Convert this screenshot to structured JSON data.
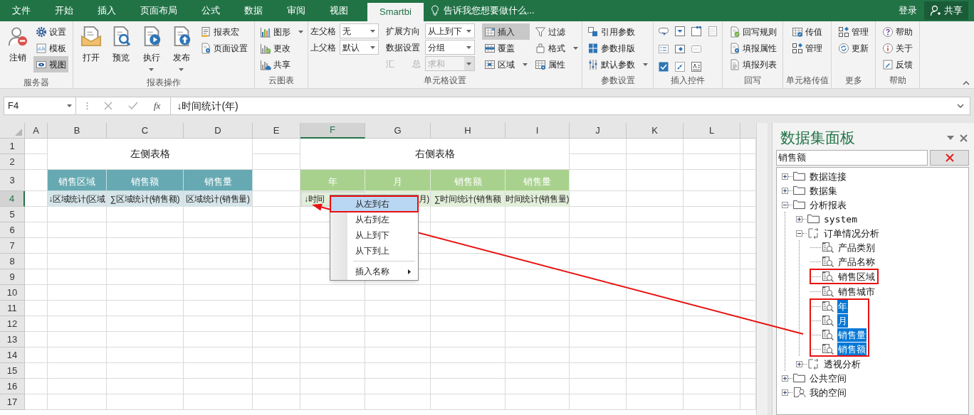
{
  "tabs": [
    {
      "label": "文件",
      "selected": false
    },
    {
      "label": "开始",
      "selected": false
    },
    {
      "label": "插入",
      "selected": false
    },
    {
      "label": "页面布局",
      "selected": false
    },
    {
      "label": "公式",
      "selected": false
    },
    {
      "label": "数据",
      "selected": false
    },
    {
      "label": "审阅",
      "selected": false
    },
    {
      "label": "视图",
      "selected": false
    },
    {
      "label": "Smartbi",
      "selected": true
    }
  ],
  "tell_me": "告诉我您想要做什么...",
  "sign_in": "登录",
  "share_button": "共享",
  "ribbon": {
    "groups": [
      {
        "label": "服务器",
        "columns": [
          {
            "kind": "large",
            "buttons": [
              {
                "label": "注销",
                "pressed": false,
                "caret": false
              }
            ]
          },
          {
            "kind": "small",
            "buttons": [
              {
                "label": "设置",
                "pressed": false,
                "caret": false
              },
              {
                "label": "模板",
                "pressed": false,
                "caret": false
              },
              {
                "label": "视图",
                "pressed": true,
                "caret": false
              }
            ]
          }
        ]
      },
      {
        "label": "报表操作",
        "columns": [
          {
            "kind": "large",
            "buttons": [
              {
                "label": "打开",
                "pressed": false,
                "caret": false
              }
            ]
          },
          {
            "kind": "large",
            "buttons": [
              {
                "label": "预览",
                "pressed": false,
                "caret": false
              }
            ]
          },
          {
            "kind": "large",
            "buttons": [
              {
                "label": "执行",
                "pressed": false,
                "caret": true
              }
            ]
          },
          {
            "kind": "large",
            "buttons": [
              {
                "label": "发布",
                "pressed": false,
                "caret": true
              }
            ]
          },
          {
            "kind": "small",
            "buttons": [
              {
                "label": "报表宏",
                "pressed": false,
                "caret": false
              },
              {
                "label": "页面设置",
                "pressed": false,
                "caret": false
              }
            ]
          }
        ]
      },
      {
        "label": "云图表",
        "columns": [
          {
            "kind": "small",
            "buttons": [
              {
                "label": "图形",
                "pressed": false,
                "caret": true
              },
              {
                "label": "更改",
                "pressed": false,
                "caret": false
              },
              {
                "label": "共享",
                "pressed": false,
                "caret": false
              }
            ]
          }
        ]
      },
      {
        "label": "单元格设置",
        "columns": [
          {
            "kind": "fields",
            "fields": [
              {
                "label": "左父格",
                "value": "无",
                "disabled": false
              },
              {
                "label": "上父格",
                "value": "默认",
                "disabled": false
              }
            ]
          },
          {
            "kind": "fields",
            "fields": [
              {
                "label": "扩展方向",
                "value": "从上到下",
                "disabled": false
              },
              {
                "label": "数据设置",
                "value": "分组",
                "disabled": false
              },
              {
                "label": "汇 总",
                "value": "求和",
                "disabled": true
              }
            ]
          },
          {
            "kind": "small",
            "buttons": [
              {
                "label": "插入",
                "pressed": true,
                "caret": false
              },
              {
                "label": "覆盖",
                "pressed": false,
                "caret": false
              },
              {
                "label": "区域",
                "pressed": false,
                "caret": true
              }
            ]
          },
          {
            "kind": "small",
            "buttons": [
              {
                "label": "过滤",
                "pressed": false,
                "caret": false
              },
              {
                "label": "格式",
                "pressed": false,
                "caret": true
              },
              {
                "label": "属性",
                "pressed": false,
                "caret": false
              }
            ]
          }
        ]
      },
      {
        "label": "参数设置",
        "columns": [
          {
            "kind": "small",
            "buttons": [
              {
                "label": "引用参数",
                "pressed": false,
                "caret": false
              },
              {
                "label": "参数排版",
                "pressed": false,
                "caret": false
              },
              {
                "label": "默认参数",
                "pressed": false,
                "caret": true
              }
            ]
          }
        ]
      },
      {
        "label": "插入控件",
        "columns": [
          {
            "kind": "controls"
          }
        ]
      },
      {
        "label": "回写",
        "columns": [
          {
            "kind": "small",
            "buttons": [
              {
                "label": "回写规则",
                "pressed": false,
                "caret": false
              },
              {
                "label": "填报属性",
                "pressed": false,
                "caret": false
              },
              {
                "label": "填报列表",
                "pressed": false,
                "caret": false
              }
            ]
          }
        ]
      },
      {
        "label": "单元格传值",
        "columns": [
          {
            "kind": "small",
            "buttons": [
              {
                "label": "传值",
                "pressed": false,
                "caret": false
              },
              {
                "label": "管理",
                "pressed": false,
                "caret": false
              }
            ]
          }
        ]
      },
      {
        "label": "更多",
        "columns": [
          {
            "kind": "small",
            "buttons": [
              {
                "label": "管理",
                "pressed": false,
                "caret": false
              },
              {
                "label": "更新",
                "pressed": false,
                "caret": false
              }
            ]
          }
        ]
      },
      {
        "label": "帮助",
        "columns": [
          {
            "kind": "small",
            "buttons": [
              {
                "label": "帮助",
                "pressed": false,
                "caret": false
              },
              {
                "label": "关于",
                "pressed": false,
                "caret": false
              },
              {
                "label": "反馈",
                "pressed": false,
                "caret": false
              }
            ]
          }
        ]
      }
    ]
  },
  "formula_bar": {
    "name_box": "F4",
    "function_label": "fx",
    "formula": "↓时间统计(年)"
  },
  "sheet": {
    "columns": [
      {
        "label": "A",
        "selected": false
      },
      {
        "label": "B",
        "selected": false
      },
      {
        "label": "C",
        "selected": false
      },
      {
        "label": "D",
        "selected": false
      },
      {
        "label": "E",
        "selected": false
      },
      {
        "label": "F",
        "selected": true
      },
      {
        "label": "G",
        "selected": false
      },
      {
        "label": "H",
        "selected": false
      },
      {
        "label": "I",
        "selected": false
      },
      {
        "label": "J",
        "selected": false
      },
      {
        "label": "K",
        "selected": false
      },
      {
        "label": "L",
        "selected": false
      }
    ],
    "rows": [
      {
        "label": "1",
        "selected": false
      },
      {
        "label": "2",
        "selected": false
      },
      {
        "label": "3",
        "selected": false
      },
      {
        "label": "4",
        "selected": true
      },
      {
        "label": "5",
        "selected": false
      },
      {
        "label": "6",
        "selected": false
      },
      {
        "label": "7",
        "selected": false
      },
      {
        "label": "8",
        "selected": false
      },
      {
        "label": "9",
        "selected": false
      },
      {
        "label": "10",
        "selected": false
      },
      {
        "label": "11",
        "selected": false
      },
      {
        "label": "12",
        "selected": false
      },
      {
        "label": "13",
        "selected": false
      },
      {
        "label": "14",
        "selected": false
      },
      {
        "label": "15",
        "selected": false
      },
      {
        "label": "16",
        "selected": false
      },
      {
        "label": "17",
        "selected": false
      }
    ],
    "left_table": {
      "title": "左侧表格",
      "headers": [
        "销售区域",
        "销售额",
        "销售量"
      ],
      "values": [
        {
          "text": "↓区域统计(区域",
          "kind": "text",
          "selected": false
        },
        {
          "text": "∑区域统计(销售额)",
          "kind": "text",
          "selected": false
        },
        {
          "text": "区域统计(销售量)",
          "kind": "text",
          "selected": false
        }
      ]
    },
    "right_table": {
      "title": "右侧表格",
      "headers": [
        "年",
        "月",
        "销售额",
        "销售量"
      ],
      "values": [
        {
          "text": "↓时间",
          "kind": "text",
          "selected": true
        },
        {
          "text": "月)",
          "kind": "tail",
          "selected": false
        },
        {
          "text": "∑时间统计(销售额",
          "kind": "text",
          "selected": false
        },
        {
          "text": "时间统计(销售量)",
          "kind": "text",
          "selected": false
        }
      ]
    }
  },
  "context_menu": {
    "items": [
      {
        "kind": "item",
        "label": "从左到右",
        "selected": true
      },
      {
        "kind": "item",
        "label": "从右到左",
        "selected": false
      },
      {
        "kind": "item",
        "label": "从上到下",
        "selected": false
      },
      {
        "kind": "item",
        "label": "从下到上",
        "selected": false
      },
      {
        "kind": "separator"
      },
      {
        "kind": "submenu",
        "label": "插入名称",
        "selected": false
      }
    ]
  },
  "panel": {
    "title": "数据集面板",
    "search": {
      "value": "销售额"
    },
    "tree": [
      {
        "label": "数据连接",
        "kind": "folder",
        "expanded": false,
        "selected": false
      },
      {
        "label": "数据集",
        "kind": "folder",
        "expanded": false,
        "selected": false
      },
      {
        "label": "分析报表",
        "kind": "folder",
        "expanded": true,
        "selected": false,
        "children": [
          {
            "label": "system",
            "kind": "folder",
            "expanded": false,
            "selected": false
          },
          {
            "label": "订单情况分析",
            "kind": "report",
            "expanded": true,
            "selected": false,
            "children": [
              {
                "label": "产品类别",
                "kind": "dataset",
                "selected": false,
                "framed": false
              },
              {
                "label": "产品名称",
                "kind": "dataset",
                "selected": false,
                "framed": false
              },
              {
                "label": "销售区域",
                "kind": "dataset",
                "selected": false,
                "framed": true
              },
              {
                "label": "销售城市",
                "kind": "dataset",
                "selected": false,
                "framed": false
              },
              {
                "label": "年",
                "kind": "dataset",
                "selected": true,
                "framed": true
              },
              {
                "label": "月",
                "kind": "dataset",
                "selected": true,
                "framed": true
              },
              {
                "label": "销售量",
                "kind": "dataset",
                "selected": true,
                "framed": true
              },
              {
                "label": "销售额",
                "kind": "dataset",
                "selected": true,
                "framed": true
              }
            ]
          },
          {
            "label": "透视分析",
            "kind": "report",
            "expanded": false,
            "selected": false
          }
        ]
      },
      {
        "label": "公共空间",
        "kind": "folder",
        "expanded": false,
        "selected": false
      },
      {
        "label": "我的空间",
        "kind": "space",
        "expanded": false,
        "selected": false
      }
    ]
  },
  "annotation_arrow": true
}
